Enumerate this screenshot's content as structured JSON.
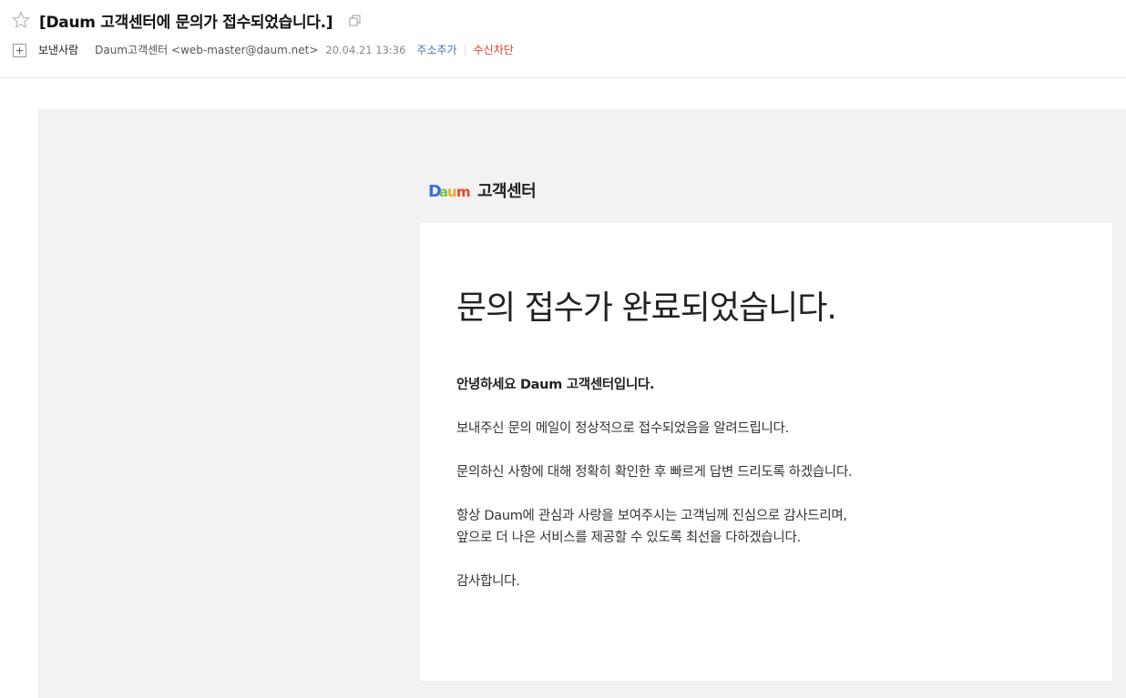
{
  "header": {
    "subject": "[Daum 고객센터에 문의가 접수되었습니다.]",
    "sender_label": "보낸사람",
    "sender_name": "Daum고객센터 <web-master@daum.net>",
    "date": "20.04.21 13:36",
    "add_address": "주소추가",
    "separator": "|",
    "block_sender": "수신차단"
  },
  "mail": {
    "logo_text": "고객센터",
    "title": "문의 접수가 완료되었습니다.",
    "greeting": "안녕하세요 Daum 고객센터입니다.",
    "line1": "보내주신 문의 메일이 정상적으로 접수되었음을 알려드립니다.",
    "line2": "문의하신 사항에 대해 정확히 확인한 후 빠르게 답변 드리도록 하겠습니다.",
    "line3a": "항상 Daum에 관심과 사랑을 보여주시는 고객님께 진심으로 감사드리며,",
    "line3b": "앞으로 더 나은 서비스를 제공할 수 있도록 최선을 다하겠습니다.",
    "closing": "감사합니다."
  },
  "colors": {
    "add_address": "#4a6fb5",
    "block_sender": "#e03a2a",
    "mail_background": "#f2f2f2"
  }
}
